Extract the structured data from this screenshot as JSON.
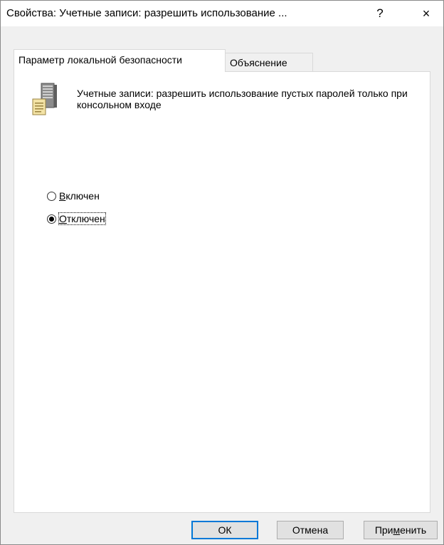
{
  "window": {
    "title": "Свойства: Учетные записи: разрешить использование ...",
    "help_label": "?",
    "close_label": "×"
  },
  "tabs": [
    {
      "label": "Параметр локальной безопасности",
      "active": true
    },
    {
      "label": "Объяснение",
      "active": false
    }
  ],
  "panel": {
    "icon": "policy-document-icon",
    "description": "Учетные записи: разрешить использование пустых паролей только при консольном входе",
    "options": [
      {
        "prefix": "",
        "accel": "В",
        "rest": "ключен",
        "selected": false
      },
      {
        "prefix": "",
        "accel": "О",
        "rest": "тключен",
        "selected": true
      }
    ]
  },
  "buttons": {
    "ok": "ОК",
    "cancel": "Отмена",
    "apply_pre": "При",
    "apply_accel": "м",
    "apply_post": "енить"
  }
}
